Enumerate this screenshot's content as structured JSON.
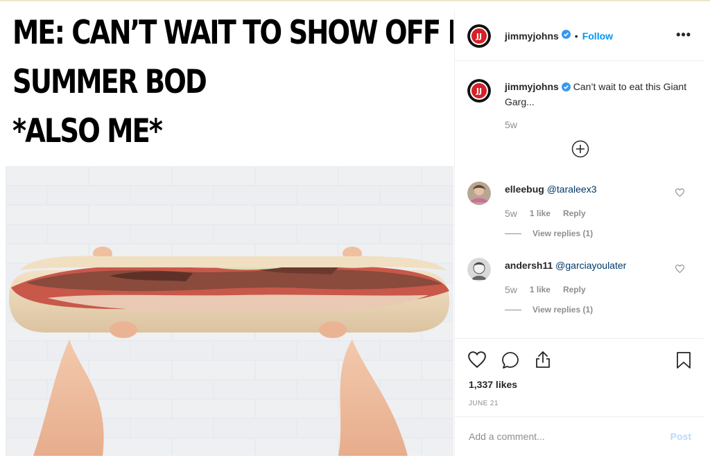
{
  "meme": {
    "lines": [
      "ME: CAN’T WAIT TO SHOW OFF MY",
      "SUMMER BOD",
      "*ALSO ME*"
    ]
  },
  "header": {
    "username": "jimmyjohns",
    "dot": "•",
    "follow_label": "Follow",
    "more_label": "•••"
  },
  "caption": {
    "username": "jimmyjohns",
    "text": "Can’t wait to eat this Giant Garg...",
    "time": "5w"
  },
  "comments": [
    {
      "username": "elleebug",
      "mention": "@taraleex3",
      "time": "5w",
      "likes": "1 like",
      "reply_label": "Reply",
      "view_replies": "View replies (1)"
    },
    {
      "username": "andersh11",
      "mention": "@garciayoulater",
      "time": "5w",
      "likes": "1 like",
      "reply_label": "Reply",
      "view_replies": "View replies (1)"
    }
  ],
  "post": {
    "likes": "1,337 likes",
    "date": "JUNE 21"
  },
  "add_comment": {
    "placeholder": "Add a comment...",
    "post_label": "Post"
  },
  "colors": {
    "follow": "#0095f6",
    "verified": "#3897f0",
    "post_disabled": "#b3dbff",
    "brand_red": "#d62027"
  },
  "icons": [
    "verified-badge-icon",
    "more-options-icon",
    "load-more-icon",
    "heart-icon",
    "comment-icon",
    "share-icon",
    "bookmark-icon"
  ]
}
